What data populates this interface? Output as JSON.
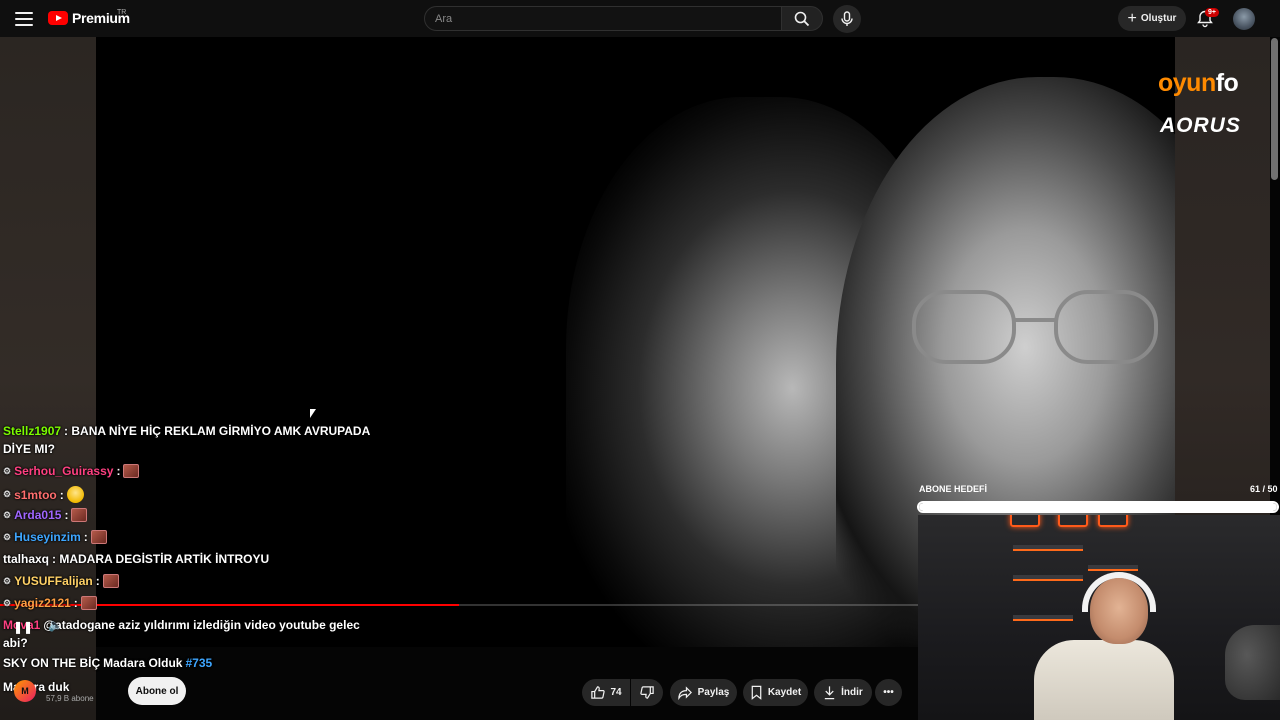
{
  "topbar": {
    "logo_text": "Premium",
    "logo_region": "TR",
    "search_placeholder": "Ara",
    "create_label": "Oluştur",
    "notification_badge": "9+"
  },
  "video": {
    "progress_fraction": 0.5,
    "sponsor_1_prefix": "oyun",
    "sponsor_1_suffix": "fo",
    "sponsor_2": "AORUS"
  },
  "chat": [
    {
      "user": "Stellz1907",
      "user_color": "#7CFC00",
      "text": ": BANA NİYE HİÇ REKLAM GİRMİYO AMK AVRUPADA"
    },
    {
      "user": "",
      "user_color": "#ffffff",
      "text": "DİYE MI?"
    },
    {
      "user": "Serhou_Guirassy",
      "user_color": "#ff4081",
      "text": ":",
      "emote": true
    },
    {
      "user": "s1mtoo",
      "user_color": "#ff6e6e",
      "text": ":",
      "face": true
    },
    {
      "user": "Arda015",
      "user_color": "#a066ff",
      "text": ":",
      "emote": true
    },
    {
      "user": "Huseyinzim",
      "user_color": "#3ea6ff",
      "text": ":",
      "emote": true
    },
    {
      "user": "ttalhaxq",
      "user_color": "#ffffff",
      "text": ": MADARA DEGİSTİR ARTİK İNTROYU"
    },
    {
      "user": "YUSUFFalijan",
      "user_color": "#ffd166",
      "text": ":",
      "emote": true
    },
    {
      "user": "yagiz2121",
      "user_color": "#ff9f43",
      "text": ":",
      "emote": true
    },
    {
      "user": "Mova1",
      "user_color": "#ff4081",
      "text": "@atadogane aziz yıldırımı izlediğin video youtube gelec"
    },
    {
      "user": "",
      "user_color": "#ffffff",
      "text": "abi?"
    },
    {
      "user": "SKY ON THE BİÇ",
      "user_color": "#ffffff",
      "text": "Madara Olduk",
      "hashtag": "#735"
    },
    {
      "user": "Madara",
      "user_color": "#ffffff",
      "text": "duk"
    }
  ],
  "channel": {
    "avatar_initials": "M",
    "subscribers": "57,9 B abone",
    "subscribe_label": "Abone ol"
  },
  "actions": {
    "like_count": "74",
    "share_label": "Paylaş",
    "save_label": "Kaydet",
    "download_label": "İndir"
  },
  "goal": {
    "label": "ABONE HEDEFİ",
    "count_text": "61 / 50",
    "current": 61,
    "target": 50
  }
}
